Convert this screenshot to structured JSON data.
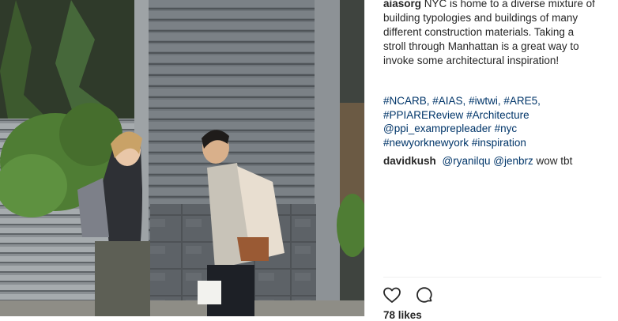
{
  "post": {
    "username": "aiasorg",
    "caption": "NYC is home to a diverse mixture of building typologies and buildings of many different construction materials. Taking a stroll through Manhattan is a great way to invoke some architectural inspiration!",
    "hashtags": [
      "#NCARB,",
      "#AIAS,",
      "#iwtwi,",
      "#ARE5,",
      "#PPIAREReview",
      "#Architecture",
      "@ppi_examprepleader",
      "#nyc",
      "#newyorknewyork",
      "#inspiration"
    ],
    "likes_text": "78 likes"
  },
  "comments": [
    {
      "username": "davidkush",
      "mentions": [
        "@ryanilqu",
        "@jenbrz"
      ],
      "text": "wow tbt"
    }
  ],
  "actions": {
    "like_icon": "heart-icon",
    "comment_icon": "comment-bubble-icon"
  },
  "colors": {
    "text": "#262626",
    "link": "#003569",
    "divider": "#efefef"
  }
}
